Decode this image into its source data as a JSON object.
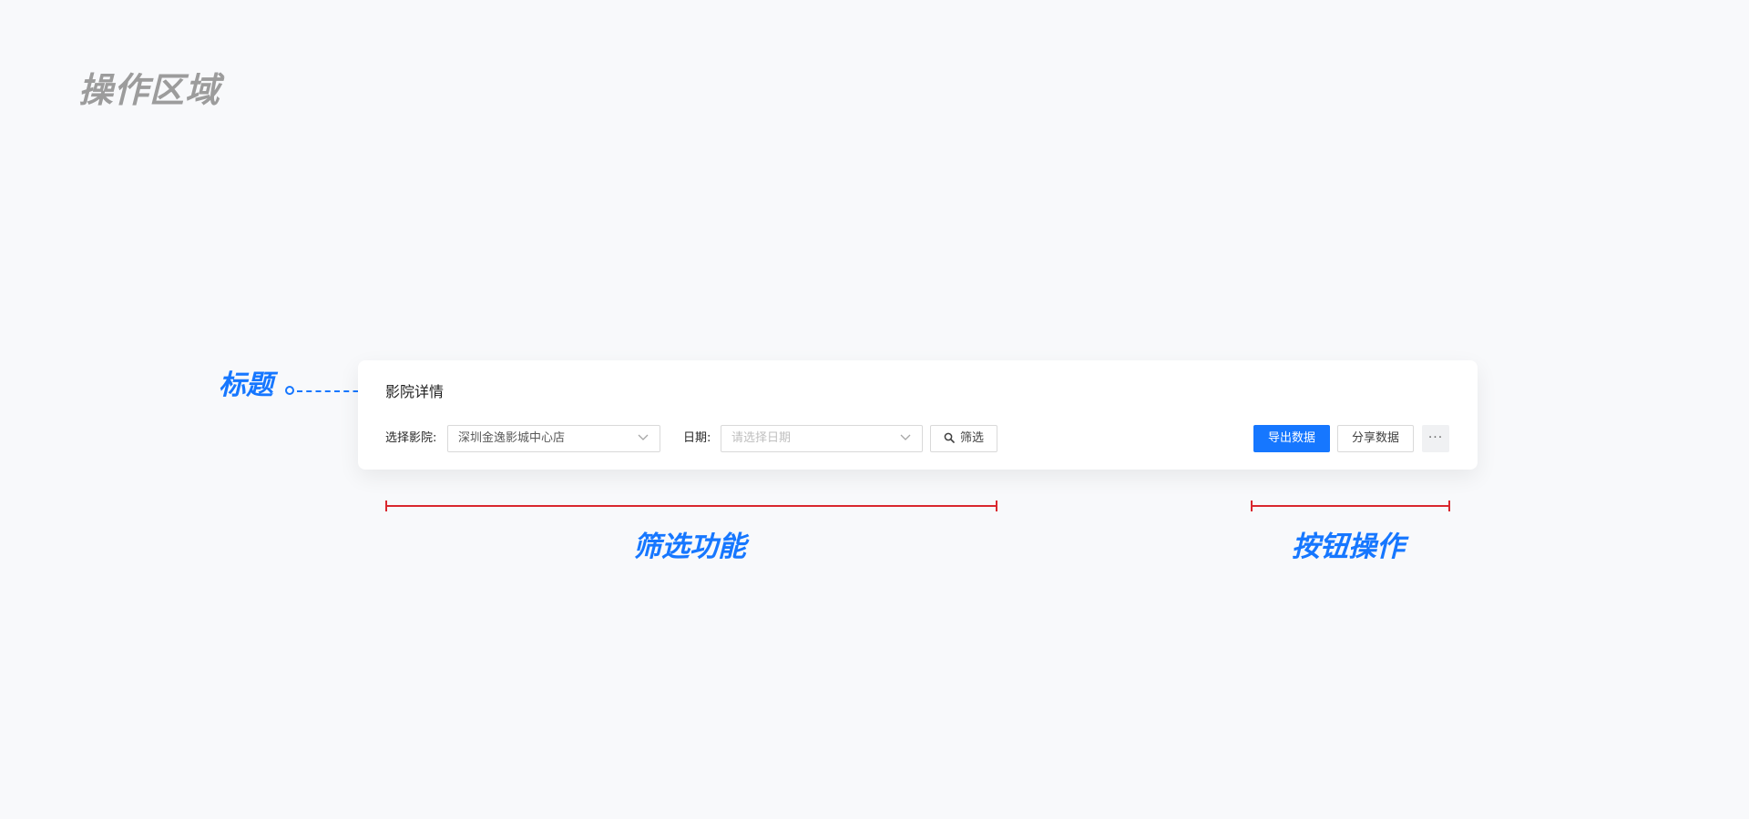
{
  "page": {
    "heading": "操作区域"
  },
  "annotations": {
    "title_label": "标题",
    "filter_label": "筛选功能",
    "button_label": "按钮操作"
  },
  "card": {
    "title": "影院详情",
    "filters": {
      "cinema_label": "选择影院:",
      "cinema_value": "深圳金逸影城中心店",
      "date_label": "日期:",
      "date_placeholder": "请选择日期",
      "filter_button": "筛选"
    },
    "actions": {
      "export": "导出数据",
      "share": "分享数据",
      "more": "···"
    }
  },
  "icons": {
    "dropdown": "chevron-down-icon",
    "search": "search-icon",
    "title_marker": "circle-marker-icon"
  },
  "colors": {
    "primary": "#1677ff",
    "annotation_bracket": "#d9272e",
    "heading_gray": "#9c9c9c",
    "background": "#f8f9fb"
  }
}
